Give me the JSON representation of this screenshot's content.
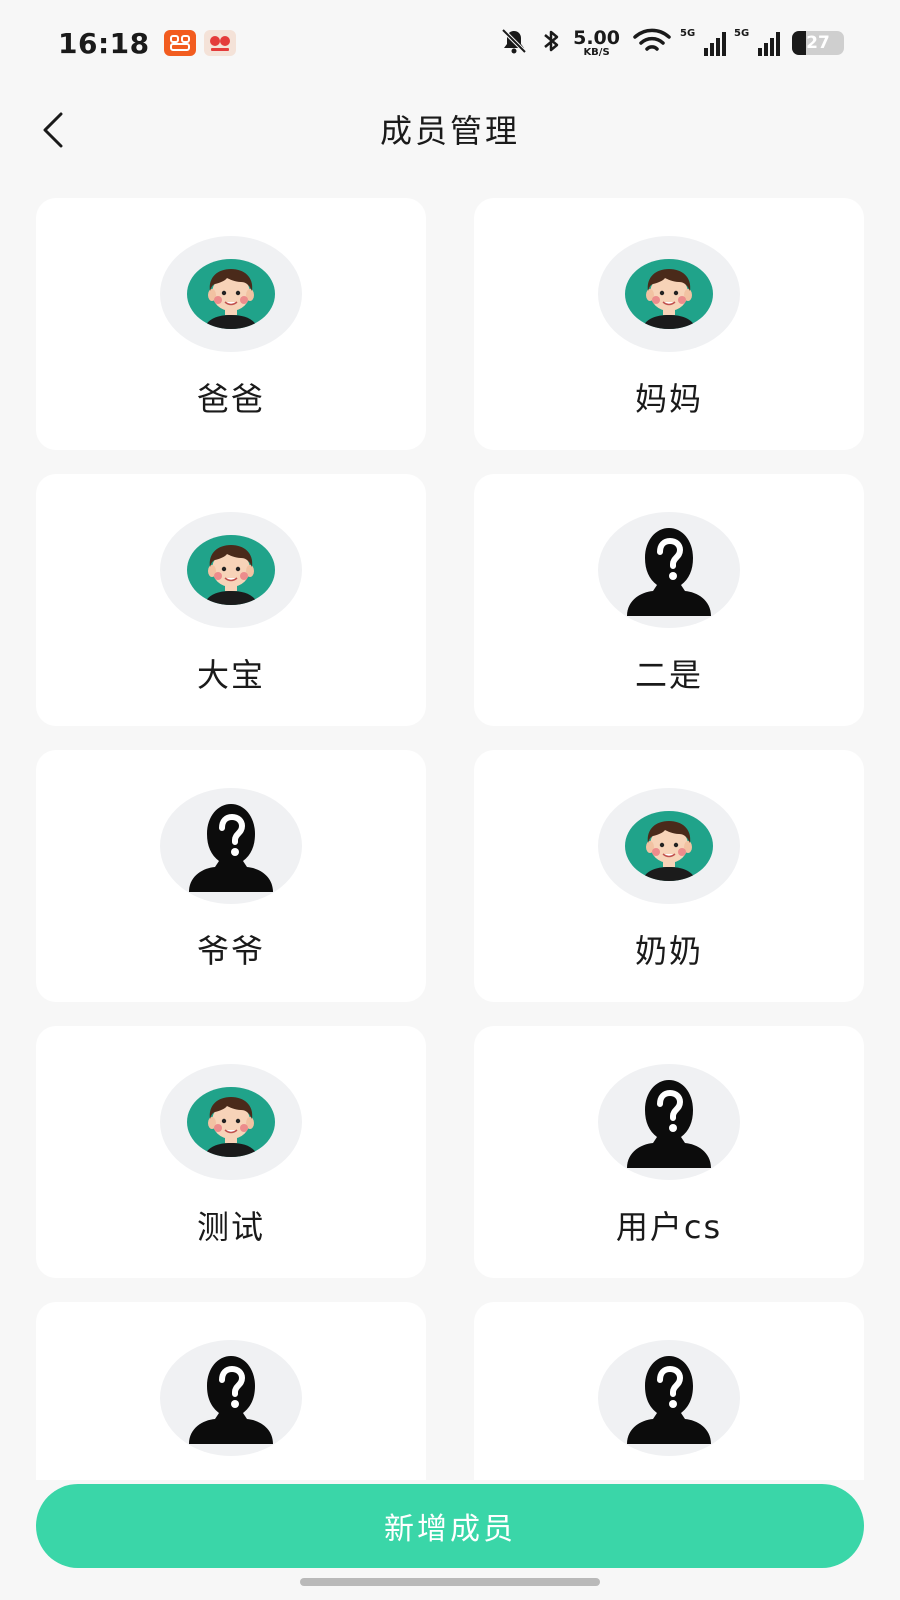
{
  "status": {
    "time": "16:18",
    "net_speed_value": "5.00",
    "net_speed_unit": "KB/S",
    "signal1_label": "5G",
    "signal2_label": "5G",
    "battery_level": "27"
  },
  "header": {
    "back_icon": "chevron-left-icon",
    "title": "成员管理"
  },
  "members": [
    {
      "name": "爸爸",
      "avatar": "boy-avatar"
    },
    {
      "name": "妈妈",
      "avatar": "boy-avatar"
    },
    {
      "name": "大宝",
      "avatar": "boy-avatar"
    },
    {
      "name": "二是",
      "avatar": "unknown-avatar"
    },
    {
      "name": "爷爷",
      "avatar": "unknown-avatar"
    },
    {
      "name": "奶奶",
      "avatar": "boy-avatar"
    },
    {
      "name": "测试",
      "avatar": "boy-avatar"
    },
    {
      "name": "用户cs",
      "avatar": "unknown-avatar"
    },
    {
      "name": "",
      "avatar": "unknown-avatar"
    },
    {
      "name": "",
      "avatar": "unknown-avatar"
    }
  ],
  "footer": {
    "add_label": "新增成员"
  },
  "colors": {
    "accent": "#3ad6a8",
    "avatar_bg": "#20a38a",
    "page_bg": "#f7f7f7"
  }
}
